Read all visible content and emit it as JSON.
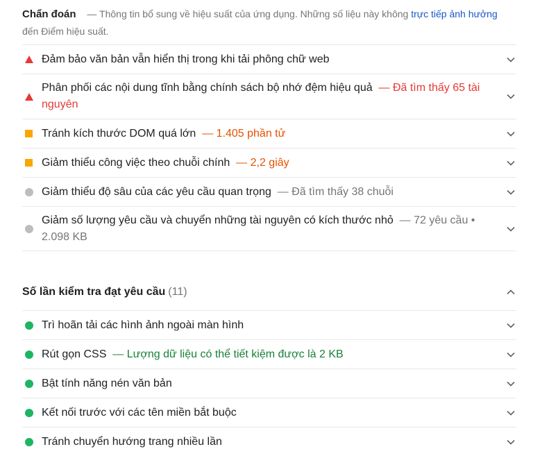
{
  "diagnostics": {
    "title": "Chẩn đoán",
    "description_prefix": "— Thông tin bổ sung về hiệu suất của ứng dụng. Những số liệu này không",
    "link_text": "trực tiếp ảnh hưởng",
    "description_suffix": "đến Điểm hiệu suất.",
    "items": [
      {
        "label": "Đảm bảo văn bản vẫn hiển thị trong khi tải phông chữ web",
        "extra": "",
        "severity": "fail",
        "icon": "red-triangle-icon"
      },
      {
        "label": "Phân phối các nội dung tĩnh bằng chính sách bộ nhớ đệm hiệu quả",
        "extra": "— Đã tìm thấy 65 tài nguyên",
        "severity": "fail",
        "icon": "red-triangle-icon"
      },
      {
        "label": "Tránh kích thước DOM quá lớn",
        "extra": "— 1.405 phần tử",
        "severity": "average",
        "icon": "orange-square-icon"
      },
      {
        "label": "Giảm thiểu công việc theo chuỗi chính",
        "extra": "— 2,2 giây",
        "severity": "average",
        "icon": "orange-square-icon"
      },
      {
        "label": "Giảm thiểu độ sâu của các yêu cầu quan trọng",
        "extra": "— Đã tìm thấy 38 chuỗi",
        "severity": "info",
        "icon": "gray-circle-icon"
      },
      {
        "label": "Giảm số lượng yêu cầu và chuyển những tài nguyên có kích thước nhỏ",
        "extra": "— 72 yêu cầu • 2.098 KB",
        "severity": "info",
        "icon": "gray-circle-icon"
      }
    ]
  },
  "passed": {
    "title": "Số lần kiểm tra đạt yêu cầu",
    "count": "(11)",
    "items": [
      {
        "label": "Trì hoãn tải các hình ảnh ngoài màn hình",
        "extra": "",
        "icon": "green-circle-icon"
      },
      {
        "label": "Rút gọn CSS",
        "extra": "— Lượng dữ liệu có thể tiết kiệm được là 2 KB",
        "icon": "green-circle-icon"
      },
      {
        "label": "Bật tính năng nén văn bản",
        "extra": "",
        "icon": "green-circle-icon"
      },
      {
        "label": "Kết nối trước với các tên miền bắt buộc",
        "extra": "",
        "icon": "green-circle-icon"
      },
      {
        "label": "Tránh chuyển hướng trang nhiều lần",
        "extra": "",
        "icon": "green-circle-icon"
      }
    ]
  },
  "colors": {
    "fail": "#e53935",
    "average": "#f9a700",
    "info": "#bdbdbd",
    "pass": "#1fb462",
    "link": "#1a56c8"
  }
}
